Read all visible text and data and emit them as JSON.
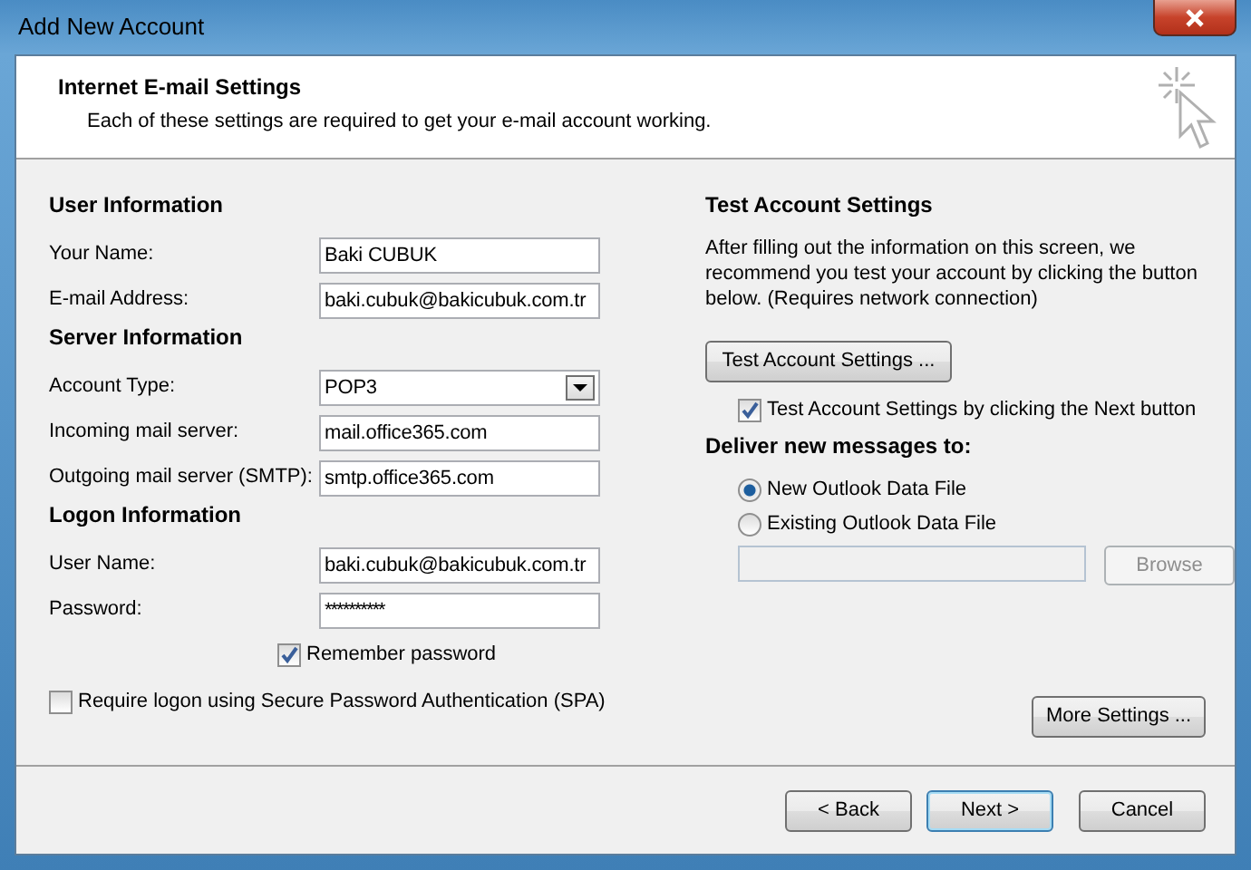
{
  "window": {
    "title": "Add New Account"
  },
  "header": {
    "title": "Internet E-mail Settings",
    "subtitle": "Each of these settings are required to get your e-mail account working."
  },
  "sections": [
    {
      "heading": "User Information",
      "fields": [
        {
          "kind": "text",
          "label": "Your Name:",
          "value": "Baki CUBUK"
        },
        {
          "kind": "text",
          "label": "E-mail Address:",
          "value": "baki.cubuk@bakicubuk.com.tr"
        }
      ]
    },
    {
      "heading": "Server Information",
      "fields": [
        {
          "kind": "select",
          "label": "Account Type:",
          "value": "POP3"
        },
        {
          "kind": "text",
          "label": "Incoming mail server:",
          "value": "mail.office365.com"
        },
        {
          "kind": "text",
          "label": "Outgoing mail server (SMTP):",
          "value": "smtp.office365.com"
        }
      ]
    },
    {
      "heading": "Logon Information",
      "fields": [
        {
          "kind": "text",
          "label": "User Name:",
          "value": "baki.cubuk@bakicubuk.com.tr"
        },
        {
          "kind": "password",
          "label": "Password:",
          "value": "**********"
        }
      ]
    }
  ],
  "remember_password": {
    "label": "Remember password",
    "checked": true
  },
  "spa": {
    "label": "Require logon using Secure Password Authentication (SPA)",
    "checked": false
  },
  "test": {
    "heading": "Test Account Settings",
    "description": "After filling out the information on this screen, we recommend you test your account by clicking the button below. (Requires network connection)",
    "button": "Test Account Settings ...",
    "on_next": {
      "label": "Test Account Settings by clicking the Next button",
      "checked": true
    }
  },
  "deliver": {
    "heading": "Deliver new messages to:",
    "options": [
      {
        "label": "New Outlook Data File",
        "selected": true
      },
      {
        "label": "Existing Outlook Data File",
        "selected": false
      }
    ],
    "browse": {
      "label": "Browse",
      "disabled": true
    }
  },
  "more_settings": "More Settings ...",
  "footer_buttons": [
    {
      "label": "< Back",
      "default": false
    },
    {
      "label": "Next >",
      "default": true
    },
    {
      "label": "Cancel",
      "default": false
    }
  ]
}
